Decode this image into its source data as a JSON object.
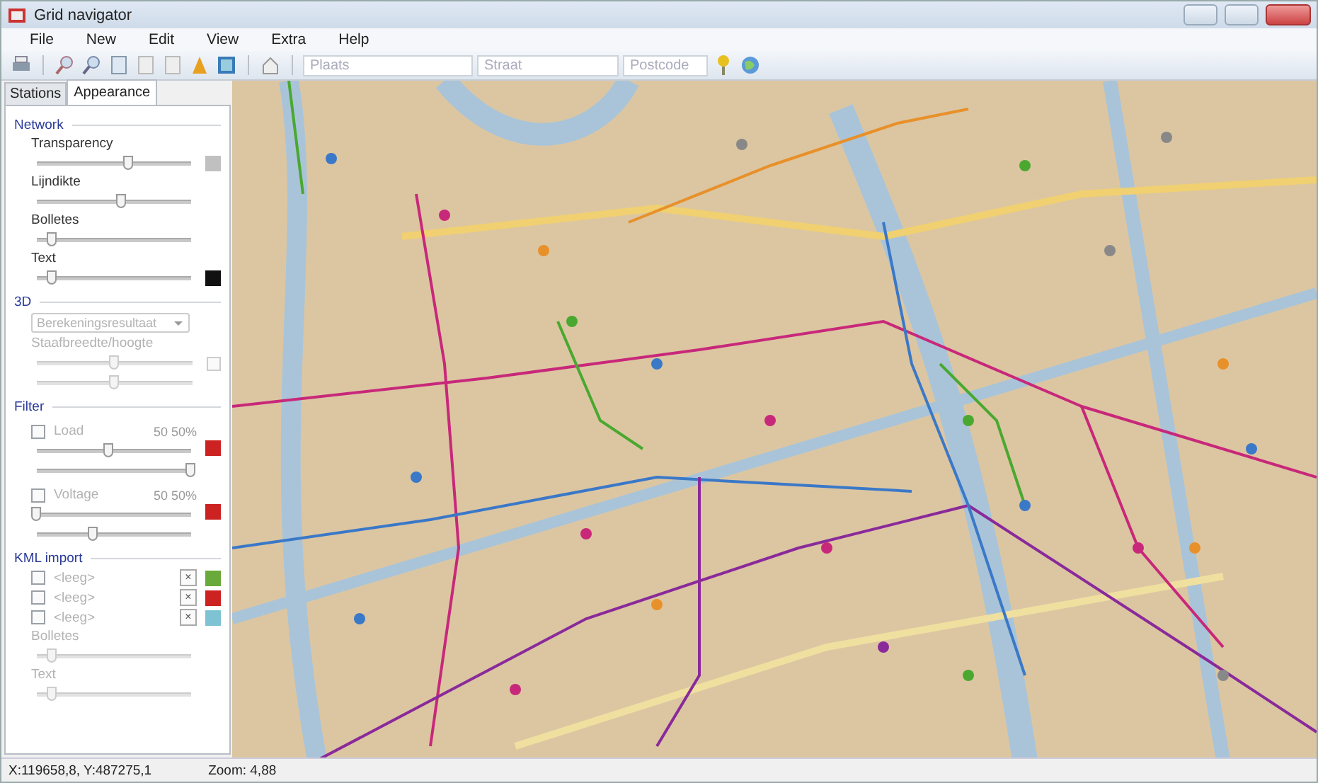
{
  "window": {
    "title": "Grid navigator"
  },
  "menu": [
    "File",
    "New",
    "Edit",
    "View",
    "Extra",
    "Help"
  ],
  "search_fields": [
    {
      "placeholder": "Plaats"
    },
    {
      "placeholder": "Straat"
    },
    {
      "placeholder": "Postcode"
    }
  ],
  "tabs": [
    {
      "label": "Stations",
      "selected": false
    },
    {
      "label": "Appearance",
      "selected": true
    }
  ],
  "sections": [
    {
      "title": "Network",
      "rows": [
        {
          "kind": "slider",
          "label": "Transparency",
          "level": 0.6,
          "color": "#c0c0c0"
        },
        {
          "kind": "slider",
          "label": "Lijndikte",
          "level": 0.55
        },
        {
          "kind": "slider",
          "label": "Bolletes",
          "level": 0.1
        },
        {
          "kind": "slider",
          "label": "Text",
          "level": 0.1,
          "color": "#111111"
        }
      ]
    },
    {
      "title": "3D",
      "rows": [
        {
          "kind": "dropdown",
          "value": "Berekeningsresultaat",
          "disabled": true
        },
        {
          "kind": "bar-size",
          "label": "Staafbreedte/hoogte",
          "disabled": true,
          "checked": false,
          "sliders": [
            {
              "level": 0.5
            },
            {
              "level": 0.5
            }
          ]
        }
      ]
    },
    {
      "title": "Filter",
      "rows": [
        {
          "kind": "filter",
          "label": "Load",
          "checked": false,
          "reading": "50 50%",
          "color": "#cc2222",
          "sliders": [
            {
              "level": 0.47
            },
            {
              "level": 1.0
            }
          ]
        },
        {
          "kind": "filter",
          "label": "Voltage",
          "checked": false,
          "reading": "50 50%",
          "color": "#cc2222",
          "sliders": [
            {
              "level": 0.0
            },
            {
              "level": 0.37
            }
          ]
        }
      ]
    },
    {
      "title": "KML import",
      "rows": [
        {
          "kind": "layer",
          "label": "<leeg>",
          "checked": false,
          "remove": "×",
          "color": "#6aaa3a"
        },
        {
          "kind": "layer",
          "label": "<leeg>",
          "checked": false,
          "remove": "×",
          "color": "#cc2222"
        },
        {
          "kind": "layer",
          "label": "<leeg>",
          "checked": false,
          "remove": "×",
          "color": "#7ec3d3"
        },
        {
          "kind": "slider",
          "label": "Bolletes",
          "level": 0.1,
          "disabled": true
        },
        {
          "kind": "slider",
          "label": "Text",
          "level": 0.1,
          "disabled": true
        }
      ]
    }
  ],
  "status_bar": {
    "coordinates": "X:119658,8, Y:487275,1",
    "zoom": "Zoom: 4,88"
  }
}
